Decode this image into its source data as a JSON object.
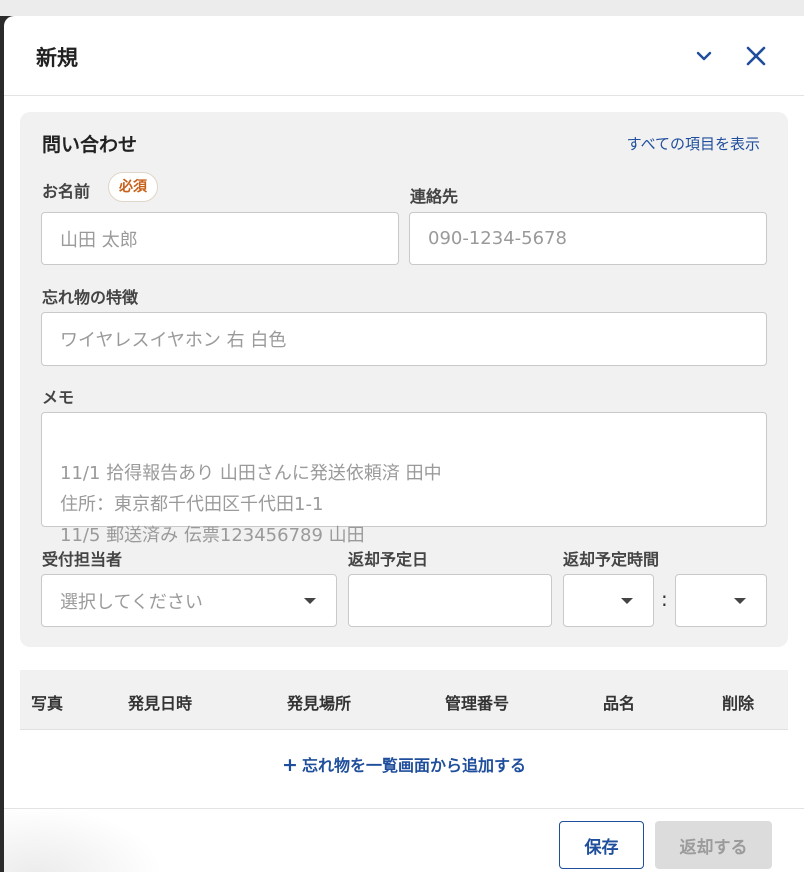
{
  "dialog": {
    "title": "新規"
  },
  "inquiry": {
    "title": "問い合わせ",
    "show_all": "すべての項目を表示",
    "name_label": "お名前",
    "required_badge": "必須",
    "name_placeholder": "山田 太郎",
    "contact_label": "連絡先",
    "contact_placeholder": "090-1234-5678",
    "features_label": "忘れ物の特徴",
    "features_placeholder": "ワイヤレスイヤホン 右 白色",
    "memo_label": "メモ",
    "memo_placeholder": "11/1 拾得報告あり 山田さんに発送依頼済 田中\n住所：東京都千代田区千代田1-1\n11/5 郵送済み 伝票123456789 山田",
    "receiver_label": "受付担当者",
    "receiver_placeholder": "選択してください",
    "return_date_label": "返却予定日",
    "return_date_value": "",
    "return_time_label": "返却予定時間",
    "time_separator": ":"
  },
  "table": {
    "headers": [
      "写真",
      "発見日時",
      "発見場所",
      "管理番号",
      "品名",
      "削除"
    ],
    "add_link": "忘れ物を一覧画面から追加する",
    "add_plus": "+"
  },
  "footer": {
    "save": "保存",
    "return": "返却する"
  },
  "colors": {
    "accent": "#1f4e9c",
    "required": "#c8601a",
    "card_bg": "#f1f1f1",
    "disabled_bg": "#dcdcdc"
  }
}
